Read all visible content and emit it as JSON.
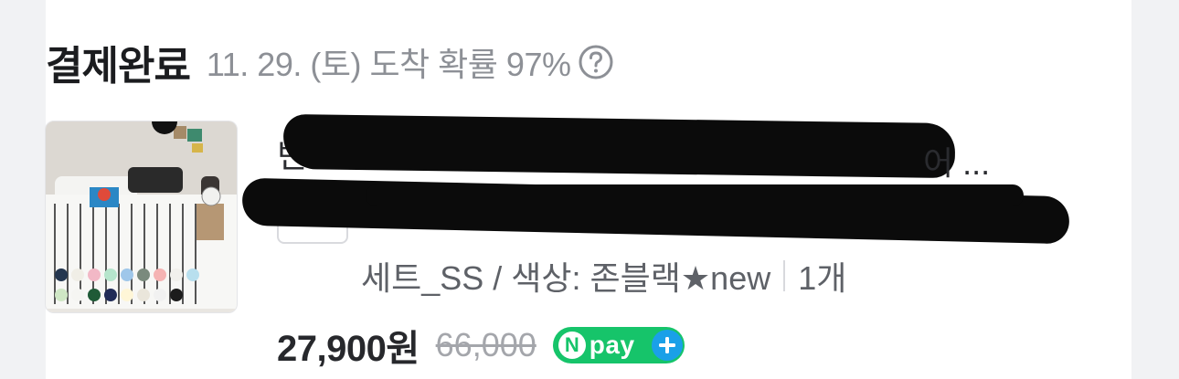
{
  "order": {
    "status": "결제완료",
    "delivery_estimate": "11. 29. (토) 도착 확률 97%"
  },
  "product": {
    "title_prefix": "빈",
    "title_suffix": "어 ...",
    "option_text": "세트_SS / 색상: 존블랙★new",
    "quantity": "1개",
    "sale_price": "27,900원",
    "original_price": "66,000",
    "npay_badge": "pay"
  },
  "colors": {
    "accent_green": "#16c46a",
    "accent_blue": "#1aa0e8"
  },
  "icons": [
    "help-circle-icon",
    "npay-logo-icon",
    "plus-icon"
  ]
}
